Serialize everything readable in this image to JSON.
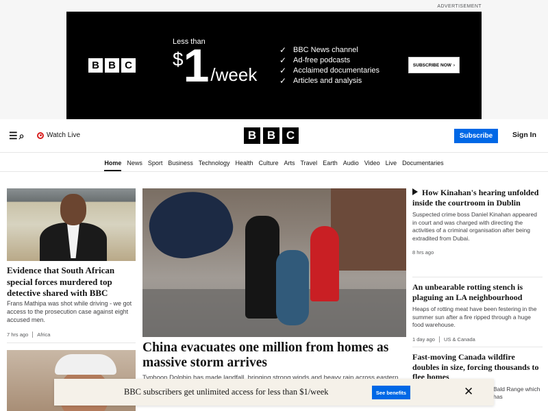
{
  "ad": {
    "label": "ADVERTISEMENT",
    "logo": [
      "B",
      "B",
      "C"
    ],
    "less_than": "Less than",
    "dollar": "$",
    "amount": "1",
    "per": "/week",
    "features": [
      "BBC News channel",
      "Ad-free podcasts",
      "Acclaimed documentaries",
      "Articles and analysis"
    ],
    "cta": "SUBSCRIBE NOW",
    "cta_icon": "chevron-right-icon"
  },
  "header": {
    "menu_icon": "menu-icon",
    "search_icon": "search-icon",
    "watch_live": "Watch Live",
    "logo": [
      "B",
      "B",
      "C"
    ],
    "subscribe": "Subscribe",
    "sign_in": "Sign In",
    "accent": "#0068e6",
    "live_color": "#d81e1e"
  },
  "nav": {
    "items": [
      "Home",
      "News",
      "Sport",
      "Business",
      "Technology",
      "Health",
      "Culture",
      "Arts",
      "Travel",
      "Earth",
      "Audio",
      "Video",
      "Live",
      "Documentaries"
    ],
    "active": "Home"
  },
  "left_story": {
    "headline": "Evidence that South African special forces murdered top detective shared with BBC",
    "summary": "Frans Mathipa was shot while driving - we got access to the prosecution case against eight accused men.",
    "time": "7 hrs ago",
    "section": "Africa"
  },
  "main_story": {
    "headline": "China evacuates one million from homes as massive storm arrives",
    "summary": "Typhoon Dolphin has made landfall, bringing strong winds and heavy rain across eastern"
  },
  "right_stories": [
    {
      "headline": "How Kinahan's hearing unfolded inside the courtroom in Dublin",
      "summary": "Suspected crime boss Daniel Kinahan appeared in court and was charged with directing the activities of a criminal organisation after being extradited from Dubai.",
      "time": "8 hrs ago",
      "section": ""
    },
    {
      "headline": "An unbearable rotting stench is plaguing an LA neighbourhood",
      "summary": "Heaps of rotting meat have been festering in the summer sun after a fire ripped through a huge food warehouse.",
      "time": "1 day ago",
      "section": "US & Canada"
    },
    {
      "headline": "Fast-moving Canada wildfire doubles in size, forcing thousands to flee homes",
      "summary": "Bald Range which has",
      "time": "",
      "section": ""
    }
  ],
  "banner": {
    "text": "BBC subscribers get unlimited access for less than $1/week",
    "button": "See benefits",
    "close_icon": "close-icon"
  }
}
